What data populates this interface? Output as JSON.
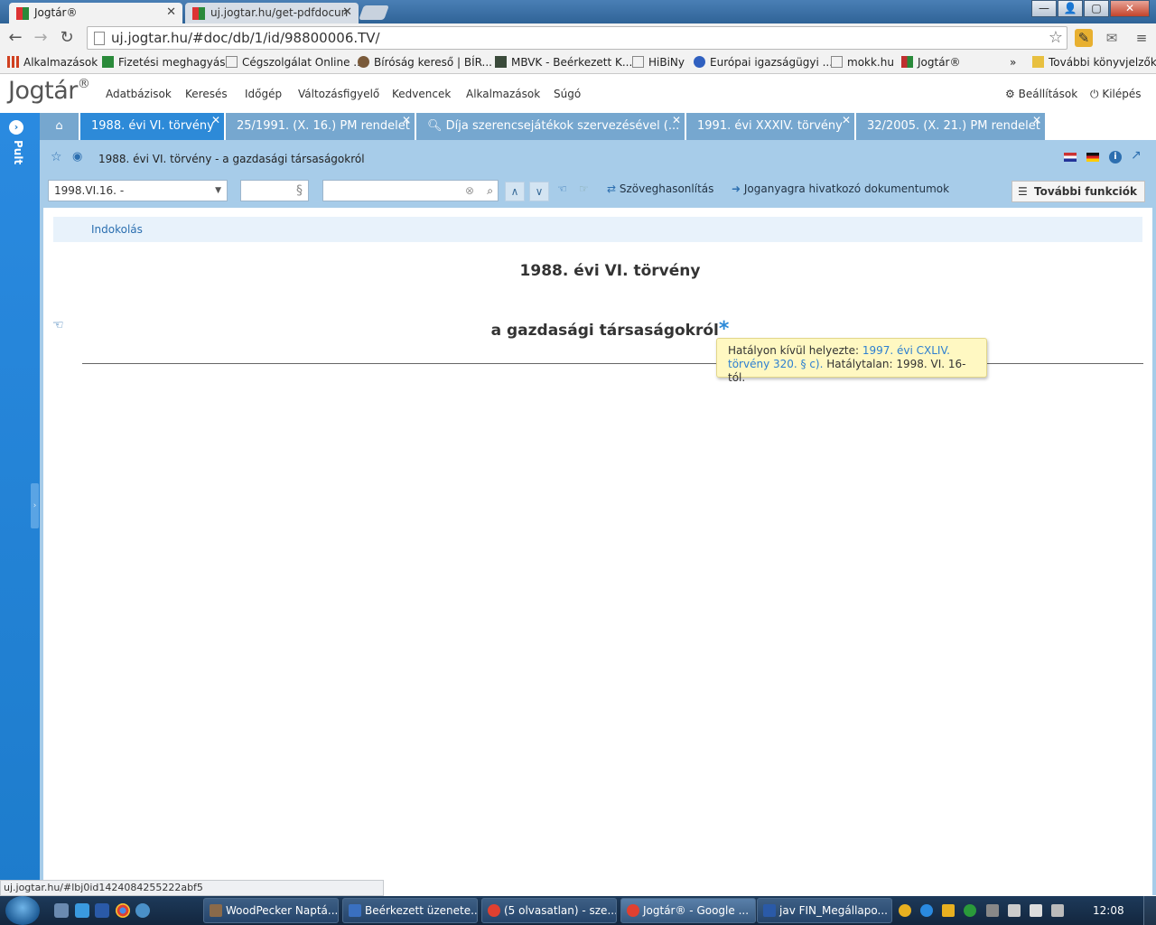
{
  "browser": {
    "tabs": [
      {
        "label": "Jogtár®",
        "active": true
      },
      {
        "label": "uj.jogtar.hu/get-pdfdocun",
        "active": false
      }
    ],
    "url": "uj.jogtar.hu/#doc/db/1/id/98800006.TV/",
    "window_controls": {
      "minimize": "—",
      "maximize": "▢",
      "close": "✕"
    }
  },
  "bookmarks": [
    {
      "label": "Alkalmazások",
      "color": "#d04020"
    },
    {
      "label": "Fizetési meghagyás",
      "color": "#2a8a3a"
    },
    {
      "label": "Cégszolgálat Online ...",
      "color": "#ffffff"
    },
    {
      "label": "Bíróság kereső | BÍR...",
      "color": "#7a5a3a"
    },
    {
      "label": "MBVK - Beérkezett K...",
      "color": "#3a4a3a"
    },
    {
      "label": "HiBiNy",
      "color": "#ffffff"
    },
    {
      "label": "Európai igazságügyi ...",
      "color": "#3060c0"
    },
    {
      "label": "mokk.hu",
      "color": "#ffffff"
    },
    {
      "label": "Jogtár®",
      "color": "#c03030"
    },
    {
      "label": "»",
      "color": ""
    },
    {
      "label": "További könyvjelzők",
      "color": "#e8c040"
    }
  ],
  "app": {
    "logo": "Jogtár",
    "logo_mark": "®",
    "nav": [
      "Adatbázisok",
      "Keresés",
      "Időgép",
      "Változásfigyelő",
      "Kedvencek",
      "Alkalmazások",
      "Súgó"
    ],
    "settings": "Beállítások",
    "logout": "Kilépés",
    "pult": "Pult"
  },
  "doc_tabs": [
    {
      "label": "1988. évi VI. törvény",
      "active": true
    },
    {
      "label": "25/1991. (X. 16.) PM rendelet",
      "active": false
    },
    {
      "label": "Díja szerencsejátékok szervezésével (...",
      "active": false
    },
    {
      "label": "1991. évi XXXIV. törvény",
      "active": false
    },
    {
      "label": "32/2005. (X. 21.) PM rendelet",
      "active": false
    }
  ],
  "doc": {
    "header_title": "1988. évi VI. törvény - a gazdasági társaságokról",
    "date_select": "1998.VI.16. -",
    "section_placeholder": "§",
    "search_value": "",
    "compare": "Szöveghasonlítás",
    "referring": "Joganyagra hivatkozó dokumentumok",
    "more_functions": "További funkciók",
    "indokolas": "Indokolás",
    "title": "1988. évi VI. törvény",
    "subtitle": "a gazdasági társaságokról",
    "asterisk": "*",
    "tooltip": {
      "prefix": "Hatályon kívül helyezte: ",
      "link": "1997. évi CXLIV. törvény 320. § c).",
      "suffix": " Hatálytalan: 1998. VI. 16-tól."
    }
  },
  "status_url": "uj.jogtar.hu/#lbj0id1424084255222abf5",
  "taskbar": {
    "tasks": [
      {
        "label": "WoodPecker Naptá...",
        "color": "#8a6a4a",
        "active": false
      },
      {
        "label": "Beérkezett üzenete...",
        "color": "#3a70c0",
        "active": false
      },
      {
        "label": "(5 olvasatlan) - sze...",
        "color": "#e04030",
        "active": false
      },
      {
        "label": "Jogtár® - Google ...",
        "color": "#e04030",
        "active": true
      },
      {
        "label": "jav FIN_Megállapo...",
        "color": "#2a5aa8",
        "active": false
      }
    ],
    "clock": "12:08"
  }
}
